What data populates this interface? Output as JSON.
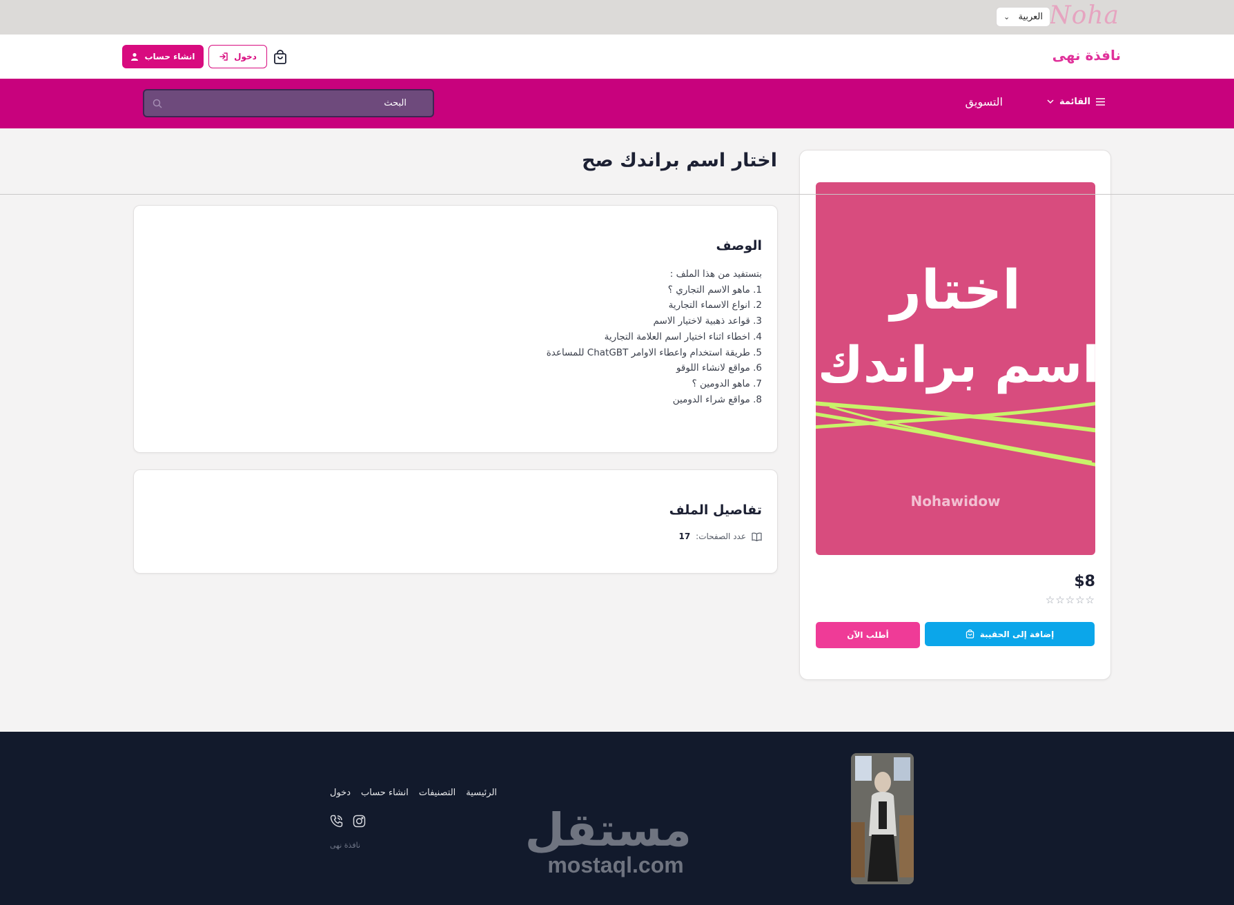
{
  "topbar": {
    "brand_script": "Noha",
    "language": "العربية"
  },
  "header": {
    "site_name": "نافذة نهى",
    "register_label": "انشاء حساب",
    "login_label": "دخول"
  },
  "navbar": {
    "menu_label": "القائمة",
    "nav_link": "التسويق",
    "search_placeholder": "البحث"
  },
  "product": {
    "title": "اختار اسم براندك صح",
    "cover_line1": "اختار",
    "cover_line2": "اسم براندك صح",
    "cover_author": "Nohawidow",
    "price": "$8",
    "rating_stars": 0,
    "add_to_bag_label": "إضافة إلى الحقيبة",
    "order_now_label": "أطلب الآن"
  },
  "description": {
    "heading": "الوصف",
    "lines": [
      "بتستفيد من هذا الملف :",
      "1. ماهو الاسم التجاري ؟",
      "2. انواع الاسماء التجارية",
      "3. قواعد ذهبية لاختيار الاسم",
      "4. اخطاء اثناء اختيار اسم العلامة التجارية",
      "5. طريقة استخدام واعطاء الاوامر ChatGBT للمساعدة",
      "6. مواقع لانشاء اللوقو",
      "7. ماهو الدومين ؟",
      "8. مواقع شراء الدومين"
    ]
  },
  "file_details": {
    "heading": "تفاصيل الملف",
    "pages_label": "عدد الصفحات:",
    "pages_value": "17"
  },
  "footer": {
    "links": [
      "الرئيسية",
      "التصنيفات",
      "انشاء حساب",
      "دخول"
    ],
    "copyright": "نافذة نهى",
    "watermark_ar": "مستقل",
    "watermark_en": "mostaql.com"
  },
  "colors": {
    "brand_pink": "#c8027d",
    "accent_pink": "#ef3b97",
    "accent_blue": "#0ba6ea",
    "footer_bg": "#121a2c",
    "cover_bg": "#d84c7e",
    "cover_stroke": "#c8f36a"
  },
  "icons": {
    "cart": "shopping-bag-icon",
    "login": "login-arrow-icon",
    "register": "user-icon",
    "menu": "hamburger-icon",
    "search": "search-icon",
    "pages": "book-icon",
    "instagram": "instagram-icon",
    "phone": "phone-icon"
  }
}
